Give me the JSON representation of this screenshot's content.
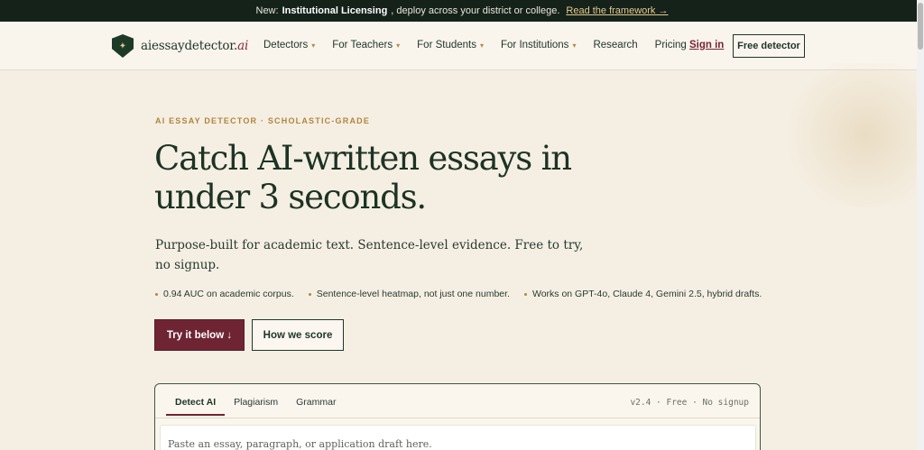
{
  "announcement": {
    "prefix": "New:",
    "highlight": "Institutional Licensing",
    "text": ", deploy across your district or college.",
    "link": "Read the framework →"
  },
  "brand": {
    "name_prefix": "aiessaydetector.",
    "name_suffix": "ai"
  },
  "nav": {
    "items": [
      {
        "label": "Detectors",
        "has_dropdown": true
      },
      {
        "label": "For Teachers",
        "has_dropdown": true
      },
      {
        "label": "For Students",
        "has_dropdown": true
      },
      {
        "label": "For Institutions",
        "has_dropdown": true
      },
      {
        "label": "Research",
        "has_dropdown": false
      },
      {
        "label": "Pricing",
        "has_dropdown": false
      }
    ],
    "signin": "Sign in",
    "cta": "Free detector"
  },
  "hero": {
    "eyebrow": "AI ESSAY DETECTOR · SCHOLASTIC-GRADE",
    "headline": "Catch AI-written essays in under 3 seconds.",
    "subheadline": "Purpose-built for academic text. Sentence-level evidence. Free to try, no signup.",
    "bullets": [
      "0.94 AUC on academic corpus.",
      "Sentence-level heatmap, not just one number.",
      "Works on GPT-4o, Claude 4, Gemini 2.5, hybrid drafts."
    ],
    "primary_button": "Try it below ↓",
    "secondary_button": "How we score"
  },
  "detector_card": {
    "tabs": [
      {
        "label": "Detect AI",
        "active": true
      },
      {
        "label": "Plagiarism",
        "active": false
      },
      {
        "label": "Grammar",
        "active": false
      }
    ],
    "meta": "v2.4 · Free · No signup",
    "input_placeholder": "Paste an essay, paragraph, or application draft here."
  },
  "colors": {
    "announcement_bg": "#15221a",
    "page_bg": "#f5efe3",
    "primary": "#6e2433",
    "text": "#1f3527",
    "accent": "#b0853e"
  }
}
